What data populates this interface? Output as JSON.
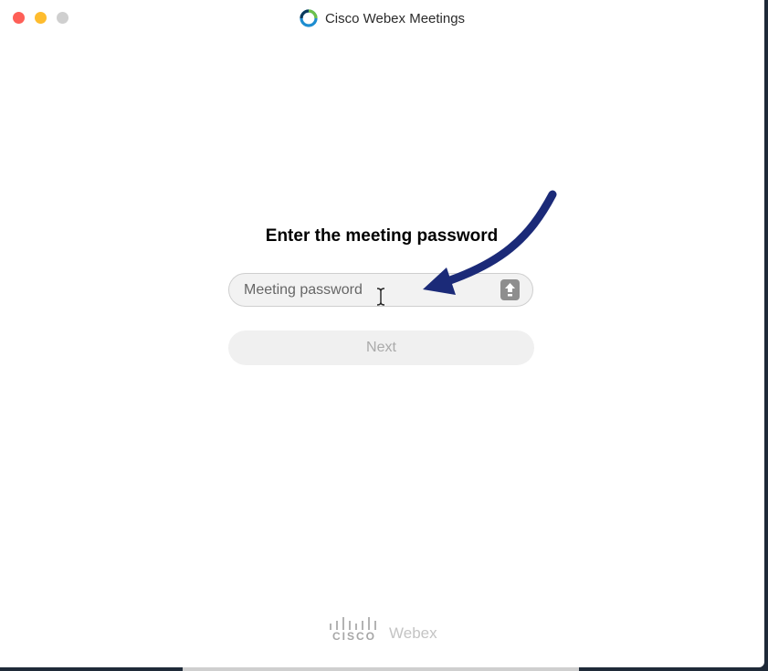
{
  "window": {
    "title": "Cisco Webex Meetings"
  },
  "icons": {
    "app": "webex-app-icon",
    "caps_lock": "caps-lock-icon",
    "cursor": "text-cursor-icon",
    "annotation": "arrow-annotation-icon",
    "logo": "cisco-logo-icon"
  },
  "dialog": {
    "heading": "Enter the meeting password",
    "password_placeholder": "Meeting password",
    "password_value": "",
    "next_label": "Next"
  },
  "footer": {
    "cisco_text": "CISCO",
    "webex_text": "Webex"
  },
  "colors": {
    "close": "#fe5f57",
    "minimize": "#febc2e",
    "maximize": "#cfcfcf",
    "annotation_arrow": "#1b2a78"
  }
}
